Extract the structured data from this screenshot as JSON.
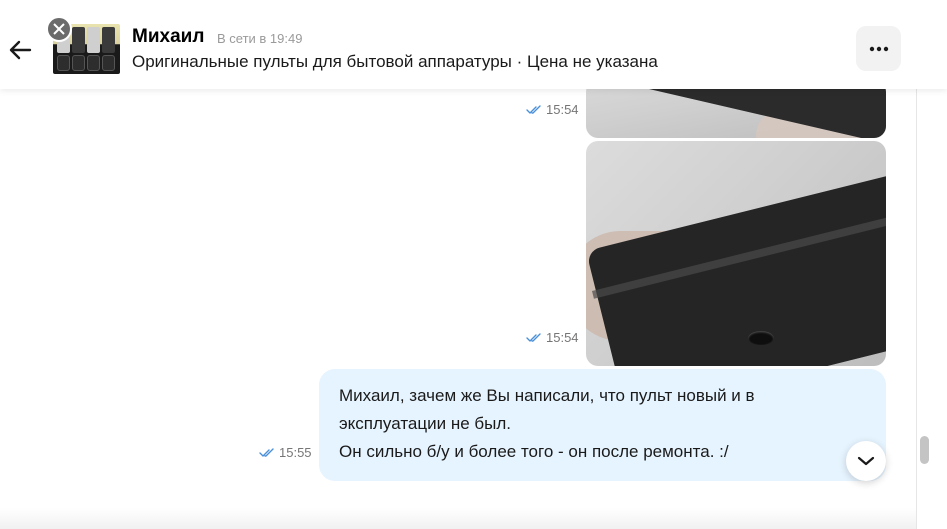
{
  "header": {
    "name": "Михаил",
    "status": "В сети в 19:49",
    "subtitle": "Оригинальные пульты для бытовой аппаратуры · Цена не указана",
    "back_icon": "arrow-left-icon",
    "menu_icon": "more-horizontal-icon"
  },
  "messages": [
    {
      "type": "image",
      "time": "15:54",
      "read": true
    },
    {
      "type": "image",
      "time": "15:54",
      "read": true
    },
    {
      "type": "text",
      "time": "15:55",
      "read": true,
      "lines": [
        "Михаил, зачем же Вы написали, что пульт новый и в",
        "эксплуатации не был.",
        "Он сильно б/у и более того - он после ремонта. :/"
      ]
    }
  ],
  "colors": {
    "bubble": "#e6f4ff",
    "check": "#4a90d9",
    "time": "#767676"
  },
  "scroll_down_icon": "chevron-down-icon"
}
